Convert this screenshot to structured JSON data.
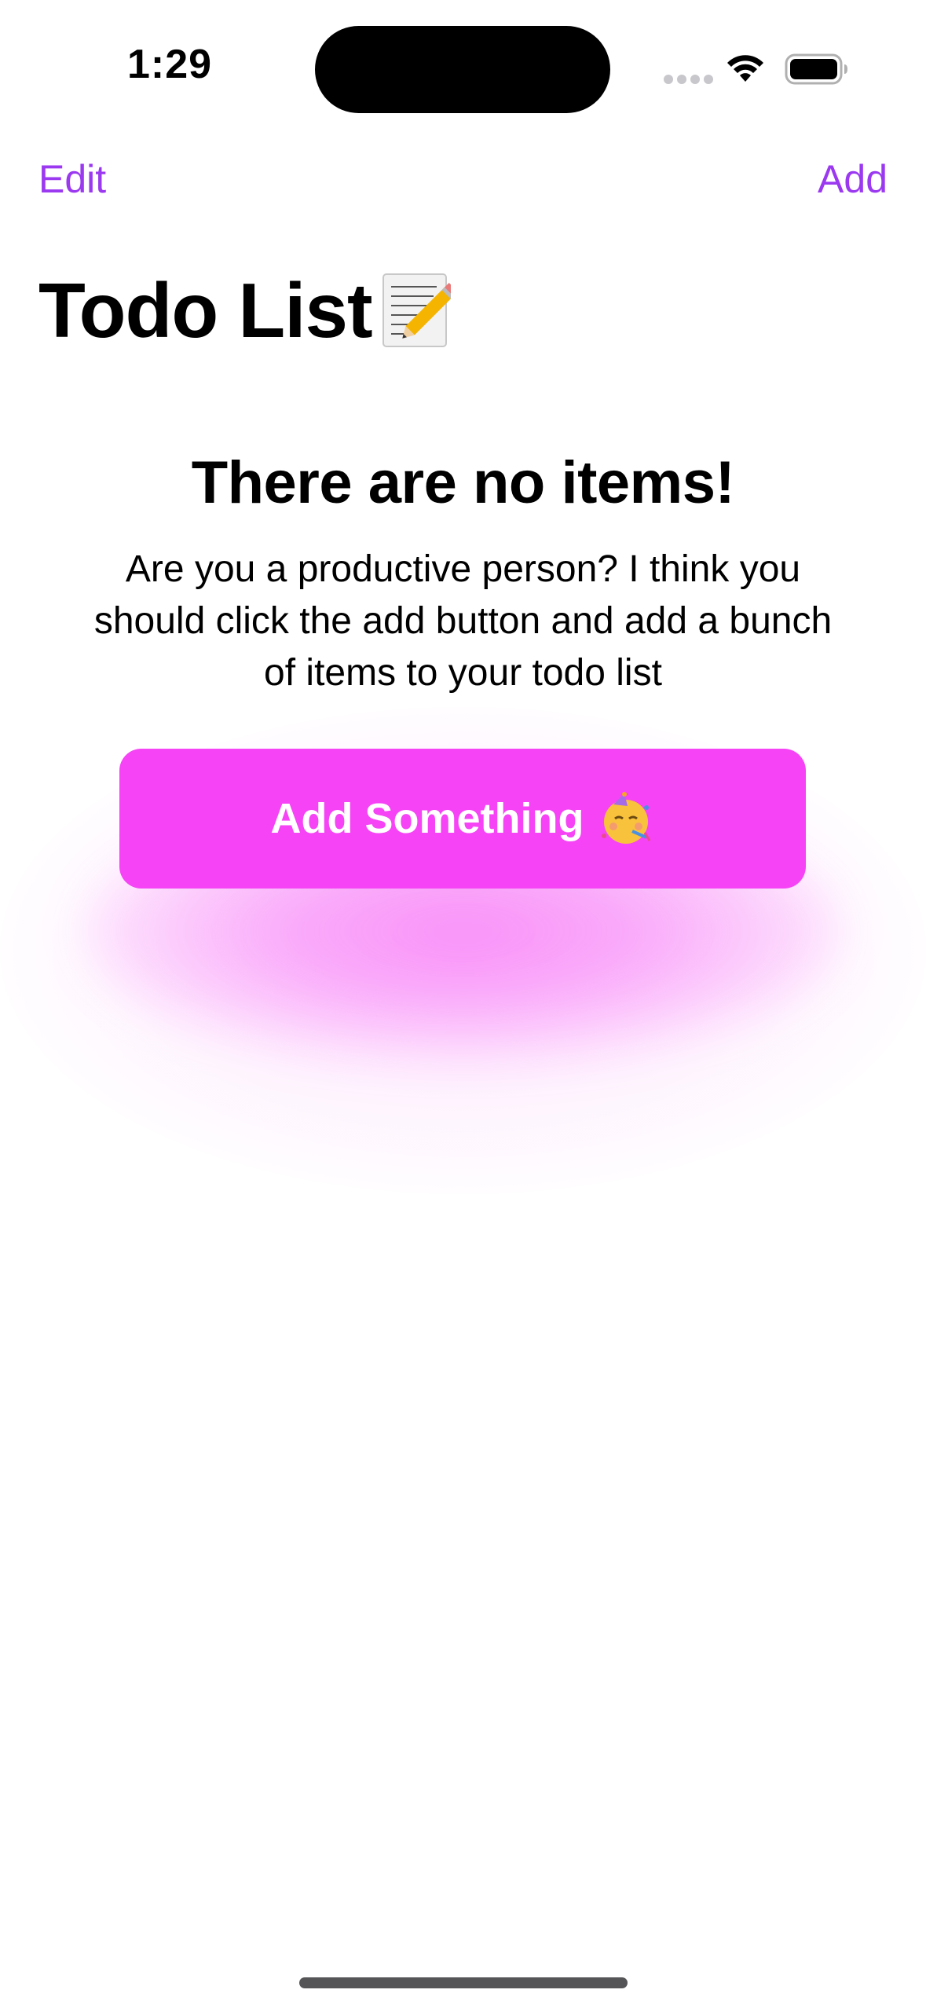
{
  "status_bar": {
    "time": "1:29"
  },
  "nav": {
    "edit_label": "Edit",
    "add_label": "Add",
    "accent_color": "#9b39f0"
  },
  "title": {
    "text": "Todo List",
    "emoji_icon": "memo-icon"
  },
  "empty_state": {
    "heading": "There are no items!",
    "message": "Are you a productive person? I think you should click the add button and add a bunch of items to your todo list",
    "button_label": "Add Something",
    "button_emoji_icon": "partying-face-icon",
    "button_color": "#f543f5"
  }
}
